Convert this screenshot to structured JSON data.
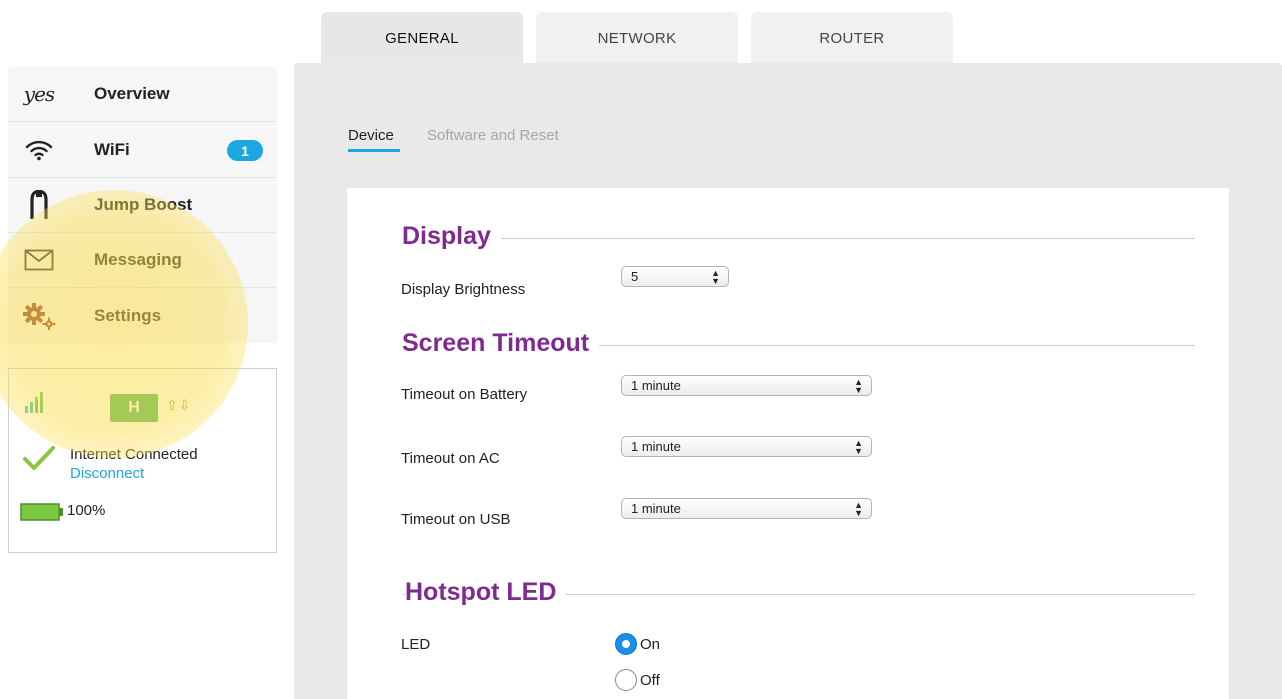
{
  "tabs": [
    {
      "label": "GENERAL",
      "active": true
    },
    {
      "label": "NETWORK",
      "active": false
    },
    {
      "label": "ROUTER",
      "active": false
    }
  ],
  "sidebar": {
    "logo_text": "yes",
    "items": [
      {
        "label": "Overview",
        "icon": "yes-logo-icon"
      },
      {
        "label": "WiFi",
        "icon": "wifi-icon",
        "badge": "1"
      },
      {
        "label": "Jump Boost",
        "icon": "jump-boost-icon"
      },
      {
        "label": "Messaging",
        "icon": "envelope-icon"
      },
      {
        "label": "Settings",
        "icon": "gears-icon"
      }
    ]
  },
  "status": {
    "network_type": "H",
    "updown_arrows": "⇧⇩",
    "connection": "Internet Connected",
    "disconnect_link": "Disconnect",
    "battery": "100%"
  },
  "subtabs": [
    {
      "label": "Device",
      "active": true
    },
    {
      "label": "Software and Reset",
      "active": false
    }
  ],
  "display": {
    "title": "Display",
    "brightness_label": "Display Brightness",
    "brightness_value": "5"
  },
  "screen_timeout": {
    "title": "Screen Timeout",
    "battery_label": "Timeout on Battery",
    "battery_value": "1 minute",
    "ac_label": "Timeout on AC",
    "ac_value": "1 minute",
    "usb_label": "Timeout on USB",
    "usb_value": "1 minute"
  },
  "hotspot_led": {
    "title": "Hotspot LED",
    "label": "LED",
    "options": [
      {
        "label": "On",
        "checked": true
      },
      {
        "label": "Off",
        "checked": false
      }
    ]
  },
  "colors": {
    "accent_blue": "#1ba7e0",
    "section_purple": "#7f2a90",
    "network_green": "#4cb35a",
    "highlight_yellow": "#fade50"
  }
}
